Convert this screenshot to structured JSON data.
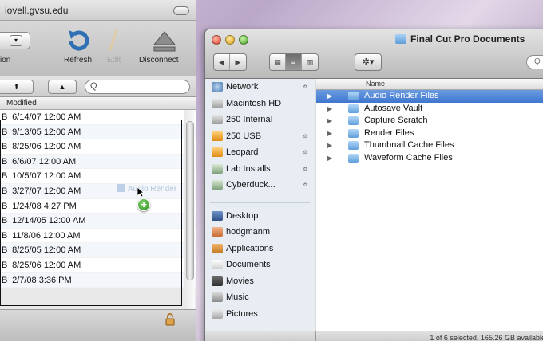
{
  "left_window": {
    "title": "iovell.gvsu.edu",
    "toolbar": {
      "connection_label": "ion",
      "refresh_label": "Refresh",
      "edit_label": "Edit",
      "disconnect_label": "Disconnect"
    },
    "nav": {
      "up_arrow": "▲",
      "search_placeholder": "Q"
    },
    "column_header": "Modified",
    "rows": [
      {
        "size": "B",
        "modified": "6/14/07 12:00 AM"
      },
      {
        "size": "B",
        "modified": "9/13/05 12:00 AM"
      },
      {
        "size": "B",
        "modified": "8/25/06 12:00 AM"
      },
      {
        "size": "B",
        "modified": "6/6/07 12:00 AM"
      },
      {
        "size": "B",
        "modified": "10/5/07 12:00 AM"
      },
      {
        "size": "B",
        "modified": "3/27/07 12:00 AM"
      },
      {
        "size": "B",
        "modified": "1/24/08 4:27 PM"
      },
      {
        "size": "B",
        "modified": "12/14/05 12:00 AM"
      },
      {
        "size": "B",
        "modified": "11/8/06 12:00 AM"
      },
      {
        "size": "B",
        "modified": "8/25/05 12:00 AM"
      },
      {
        "size": "B",
        "modified": "8/25/06 12:00 AM"
      },
      {
        "size": "B",
        "modified": "2/7/08 3:36 PM"
      }
    ],
    "drag_ghost_label": "Audio Render"
  },
  "right_window": {
    "title": "Final Cut Pro Documents",
    "search_placeholder": "Q",
    "sidebar_devices": [
      {
        "label": "Network",
        "icon": "network-icon",
        "eject": "≏"
      },
      {
        "label": "Macintosh HD",
        "icon": "hard-drive-icon",
        "eject": ""
      },
      {
        "label": "250 Internal",
        "icon": "hard-drive-icon",
        "eject": ""
      },
      {
        "label": "250 USB",
        "icon": "external-drive-icon",
        "eject": "≏"
      },
      {
        "label": "Leopard",
        "icon": "external-drive-icon",
        "eject": "≏"
      },
      {
        "label": "Lab Installs",
        "icon": "disk-image-icon",
        "eject": "≏"
      },
      {
        "label": "Cyberduck...",
        "icon": "disk-image-icon",
        "eject": "≏"
      }
    ],
    "sidebar_places": [
      {
        "label": "Desktop",
        "icon": "desktop-icon"
      },
      {
        "label": "hodgmanm",
        "icon": "home-icon"
      },
      {
        "label": "Applications",
        "icon": "applications-icon"
      },
      {
        "label": "Documents",
        "icon": "documents-icon"
      },
      {
        "label": "Movies",
        "icon": "movies-icon"
      },
      {
        "label": "Music",
        "icon": "music-icon"
      },
      {
        "label": "Pictures",
        "icon": "pictures-icon"
      }
    ],
    "column_name": "Name",
    "files": [
      {
        "name": "Audio Render Files",
        "selected": true
      },
      {
        "name": "Autosave Vault",
        "selected": false
      },
      {
        "name": "Capture Scratch",
        "selected": false
      },
      {
        "name": "Render Files",
        "selected": false
      },
      {
        "name": "Thumbnail Cache Files",
        "selected": false
      },
      {
        "name": "Waveform Cache Files",
        "selected": false
      }
    ],
    "status_text": "1 of 6 selected, 165.26 GB available"
  },
  "colors": {
    "selection_blue": "#3f76cf",
    "sidebar_bg": "#e8edf3",
    "desktop_purple": "#bba8c9"
  }
}
